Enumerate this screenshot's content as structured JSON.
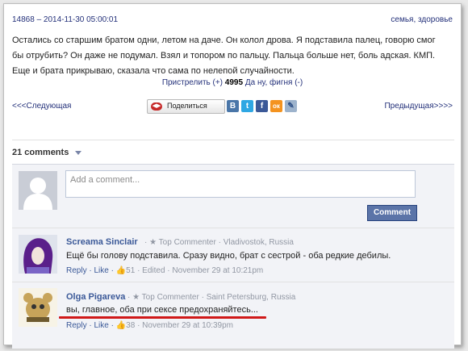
{
  "story": {
    "id_date": "14868 – 2014-11-30 05:00:01",
    "tags": "семья, здоровье",
    "text": "Остались со старшим братом одни, летом на даче. Он колол дрова. Я подставила палец, говорю смог бы отрубить? Он даже не подумал. Взял и топором по пальцу. Пальца больше нет, боль адская. КМП. Еще и брата прикрываю, сказала что сама по нелепой случайности.",
    "vote_up": "Пристрелить (+)",
    "score": "4995",
    "vote_down": "Да ну, фигня (-)"
  },
  "nav": {
    "next": "<<<Следующая",
    "prev": "Предыдущая>>>>"
  },
  "share": {
    "button_label": "Поделиться",
    "networks": [
      {
        "icon": "vk-icon",
        "glyph": "В",
        "color": "#4a76a8"
      },
      {
        "icon": "twitter-icon",
        "glyph": "t",
        "color": "#2fa7e3"
      },
      {
        "icon": "facebook-icon",
        "glyph": "f",
        "color": "#3b5998"
      },
      {
        "icon": "odnoklassniki-icon",
        "glyph": "ок",
        "color": "#f4931f"
      },
      {
        "icon": "livejournal-icon",
        "glyph": "✎",
        "color": "#9db3cc"
      }
    ]
  },
  "comments_section": {
    "count_label": "21 comments",
    "input_placeholder": "Add a comment...",
    "comment_button": "Comment"
  },
  "comments": [
    {
      "name": "Screama Sinclair",
      "meta": "· ★ Top Commenter · Vladivostok, Russia",
      "text": "Ещё бы голову подставила. Сразу видно, брат с сестрой - оба редкие дебилы.",
      "reply": "Reply",
      "like": "· Like ·",
      "likes": "51",
      "tail": "· Edited · November 29 at 10:21pm"
    },
    {
      "name": "Olga Pigareva",
      "meta": "· ★ Top Commenter · Saint Petersburg, Russia",
      "text": "вы, главное, оба при сексе предохраняйтесь...",
      "reply": "Reply",
      "like": "· Like ·",
      "likes": "38",
      "tail": "· November 29 at 10:39pm"
    }
  ],
  "colors": {
    "link": "#24317a",
    "fb_blue": "#3b5998",
    "highlight": "#d01818"
  }
}
